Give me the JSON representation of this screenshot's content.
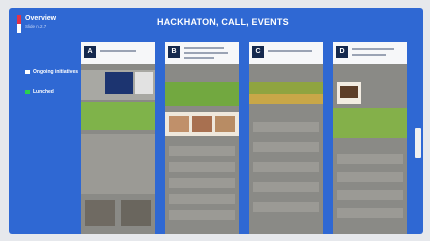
{
  "header": {
    "overview_title": "Overview",
    "overview_subtitle": "Slide n.2.7",
    "main_title": "HACKHATON, CALL, EVENTS"
  },
  "legend": [
    {
      "label": "Ongoing initiatives",
      "icon": "white-square-icon",
      "color": "#ffffff"
    },
    {
      "label": "Lunched",
      "icon": "green-square-icon",
      "color": "#2ad14e"
    }
  ],
  "columns": [
    {
      "badge": "A"
    },
    {
      "badge": "B"
    },
    {
      "badge": "C"
    },
    {
      "badge": "D"
    }
  ],
  "colors": {
    "slide_background": "#2f68d3",
    "column_background": "#8a8a86",
    "badge": "#15294e",
    "flag_red": "#e2334a",
    "launched_green": "#2ad14e"
  }
}
